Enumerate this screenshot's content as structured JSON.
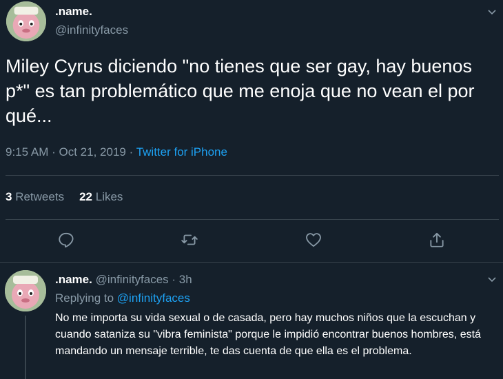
{
  "main_tweet": {
    "display_name": ".name.",
    "handle": "@infinityfaces",
    "text": "Miley Cyrus diciendo \"no tienes que ser gay, hay buenos p*\" es tan problemático que me enoja que no vean el por qué...",
    "time": "9:15 AM",
    "date": "Oct 21, 2019",
    "separator": "·",
    "source": "Twitter for iPhone",
    "retweets_count": "3",
    "retweets_label": "Retweets",
    "likes_count": "22",
    "likes_label": "Likes"
  },
  "reply": {
    "display_name": ".name.",
    "handle_time": "@infinityfaces · 3h",
    "replying_prefix": "Replying to",
    "replying_to": "@infinityfaces",
    "text": "No me importa su vida sexual o de casada, pero hay muchos niños que la escuchan y cuando sataniza su \"vibra feminista\" porque le impidió encontrar buenos hombres, está mandando un mensaje terrible, te das cuenta de que ella es el problema."
  },
  "icons": {
    "reply": "comment-icon",
    "retweet": "retweet-icon",
    "like": "heart-icon",
    "share": "share-icon",
    "menu": "chevron-down-icon"
  },
  "colors": {
    "background": "#15202b",
    "text_primary": "#ffffff",
    "text_secondary": "#8899a6",
    "accent": "#1da1f2",
    "divider": "#38444d"
  }
}
